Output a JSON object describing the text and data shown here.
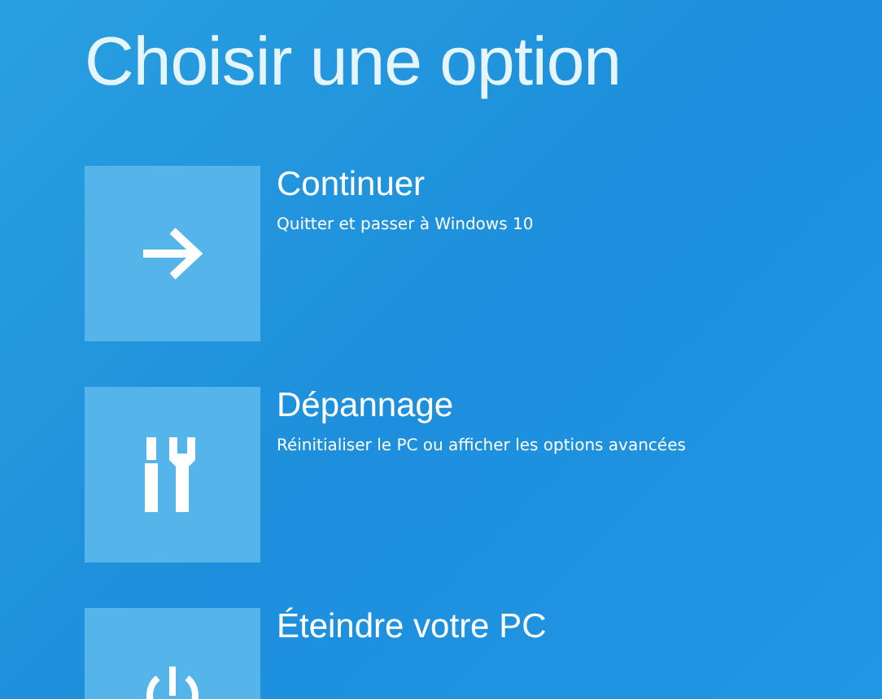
{
  "title": "Choisir une option",
  "options": [
    {
      "kind": "arrow",
      "label": "Continuer",
      "description": "Quitter et passer à Windows 10"
    },
    {
      "kind": "tools",
      "label": "Dépannage",
      "description": "Réinitialiser le PC ou afficher les options avancées"
    },
    {
      "kind": "power",
      "label": "Éteindre votre PC"
    }
  ]
}
